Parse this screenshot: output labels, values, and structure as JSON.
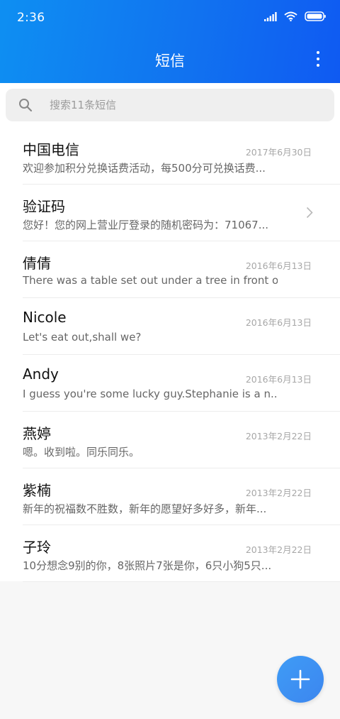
{
  "status_bar": {
    "time": "2:36",
    "icons": [
      "signal-icon",
      "wifi-icon",
      "battery-icon"
    ]
  },
  "header": {
    "title": "短信",
    "menu_icon": "more-vertical-icon"
  },
  "search": {
    "placeholder": "搜索11条短信",
    "icon": "search-icon"
  },
  "messages": [
    {
      "name": "中国电信",
      "preview": "欢迎参加积分兑换话费活动，每500分可兑换话费...",
      "date": "2017年6月30日"
    },
    {
      "name": "验证码",
      "preview": "您好！您的网上营业厅登录的随机密码为：71067...",
      "date": ""
    },
    {
      "name": "倩倩",
      "preview": "There was a table set out under a tree in front o...",
      "date": "2016年6月13日"
    },
    {
      "name": "Nicole",
      "preview": "Let's eat out,shall we?",
      "date": "2016年6月13日"
    },
    {
      "name": "Andy",
      "preview": "I guess you're some lucky guy.Stephanie is a n...",
      "date": "2016年6月13日"
    },
    {
      "name": "燕婷",
      "preview": "嗯。收到啦。同乐同乐。",
      "date": "2013年2月22日"
    },
    {
      "name": "紫楠",
      "preview": "新年的祝福数不胜数，新年的愿望好多好多，新年...",
      "date": "2013年2月22日"
    },
    {
      "name": "子玲",
      "preview": "10分想念9别的你，8张照片7张是你，6只小狗5只...",
      "date": "2013年2月22日"
    }
  ],
  "fab": {
    "icon": "plus-icon"
  },
  "colors": {
    "header_start": "#0e8ff2",
    "header_end": "#0f5af2",
    "fab": "#3f8fef"
  }
}
